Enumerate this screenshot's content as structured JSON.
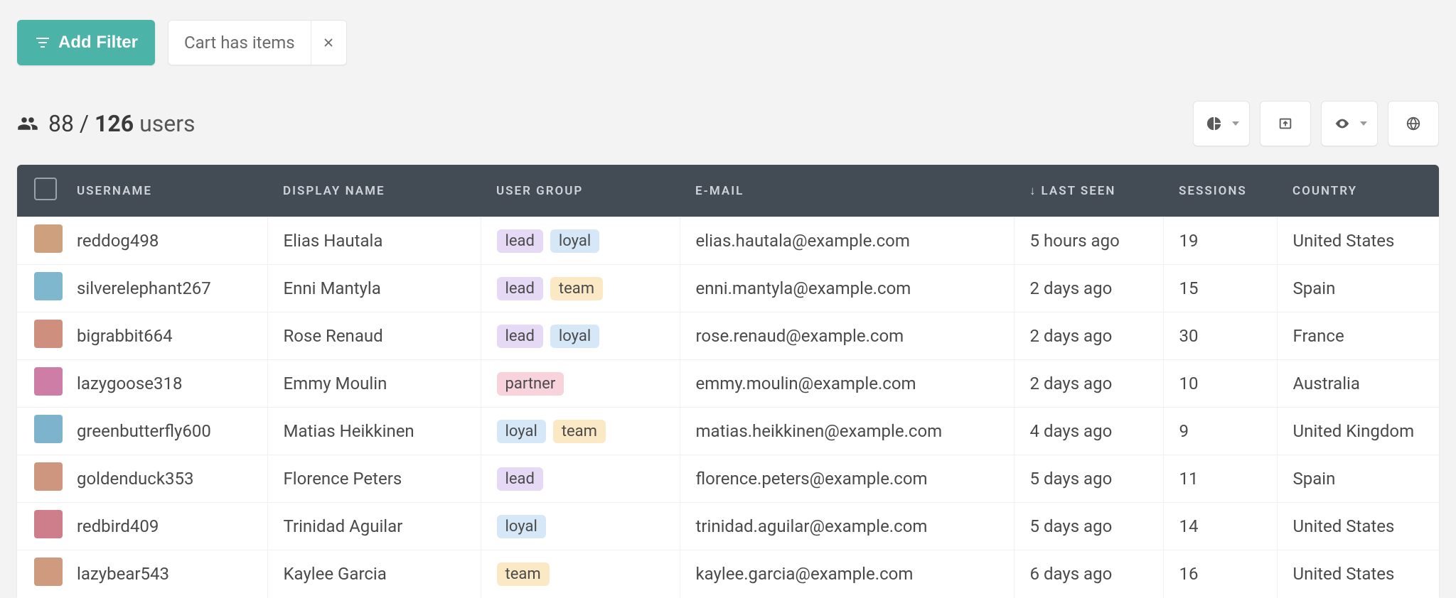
{
  "filters": {
    "add_label": "Add Filter",
    "active": [
      {
        "label": "Cart has items"
      }
    ]
  },
  "summary": {
    "filtered": "88",
    "separator": "/",
    "total": "126",
    "suffix": "users"
  },
  "columns": {
    "username": "USERNAME",
    "display_name": "DISPLAY NAME",
    "user_group": "USER GROUP",
    "email": "E-MAIL",
    "last_seen": "LAST SEEN",
    "sessions": "SESSIONS",
    "country": "COUNTRY",
    "sort_indicator": "↓"
  },
  "tag_colors": {
    "lead": "#e6d9f5",
    "loyal": "#d6e8f7",
    "team": "#fbe9c6",
    "partner": "#f8d3dc"
  },
  "rows": [
    {
      "avatar_hue": 26,
      "username": "reddog498",
      "display_name": "Elias Hautala",
      "groups": [
        "lead",
        "loyal"
      ],
      "email": "elias.hautala@example.com",
      "last_seen": "5 hours ago",
      "sessions": "19",
      "country": "United States"
    },
    {
      "avatar_hue": 197,
      "username": "silverelephant267",
      "display_name": "Enni Mantyla",
      "groups": [
        "lead",
        "team"
      ],
      "email": "enni.mantyla@example.com",
      "last_seen": "2 days ago",
      "sessions": "15",
      "country": "Spain"
    },
    {
      "avatar_hue": 13,
      "username": "bigrabbit664",
      "display_name": "Rose Renaud",
      "groups": [
        "lead",
        "loyal"
      ],
      "email": "rose.renaud@example.com",
      "last_seen": "2 days ago",
      "sessions": "30",
      "country": "France"
    },
    {
      "avatar_hue": 330,
      "username": "lazygoose318",
      "display_name": "Emmy Moulin",
      "groups": [
        "partner"
      ],
      "email": "emmy.moulin@example.com",
      "last_seen": "2 days ago",
      "sessions": "10",
      "country": "Australia"
    },
    {
      "avatar_hue": 200,
      "username": "greenbutterfly600",
      "display_name": "Matias Heikkinen",
      "groups": [
        "loyal",
        "team"
      ],
      "email": "matias.heikkinen@example.com",
      "last_seen": "4 days ago",
      "sessions": "9",
      "country": "United Kingdom"
    },
    {
      "avatar_hue": 18,
      "username": "goldenduck353",
      "display_name": "Florence Peters",
      "groups": [
        "lead"
      ],
      "email": "florence.peters@example.com",
      "last_seen": "5 days ago",
      "sessions": "11",
      "country": "Spain"
    },
    {
      "avatar_hue": 350,
      "username": "redbird409",
      "display_name": "Trinidad Aguilar",
      "groups": [
        "loyal"
      ],
      "email": "trinidad.aguilar@example.com",
      "last_seen": "5 days ago",
      "sessions": "14",
      "country": "United States"
    },
    {
      "avatar_hue": 22,
      "username": "lazybear543",
      "display_name": "Kaylee Garcia",
      "groups": [
        "team"
      ],
      "email": "kaylee.garcia@example.com",
      "last_seen": "6 days ago",
      "sessions": "16",
      "country": "United States"
    }
  ]
}
